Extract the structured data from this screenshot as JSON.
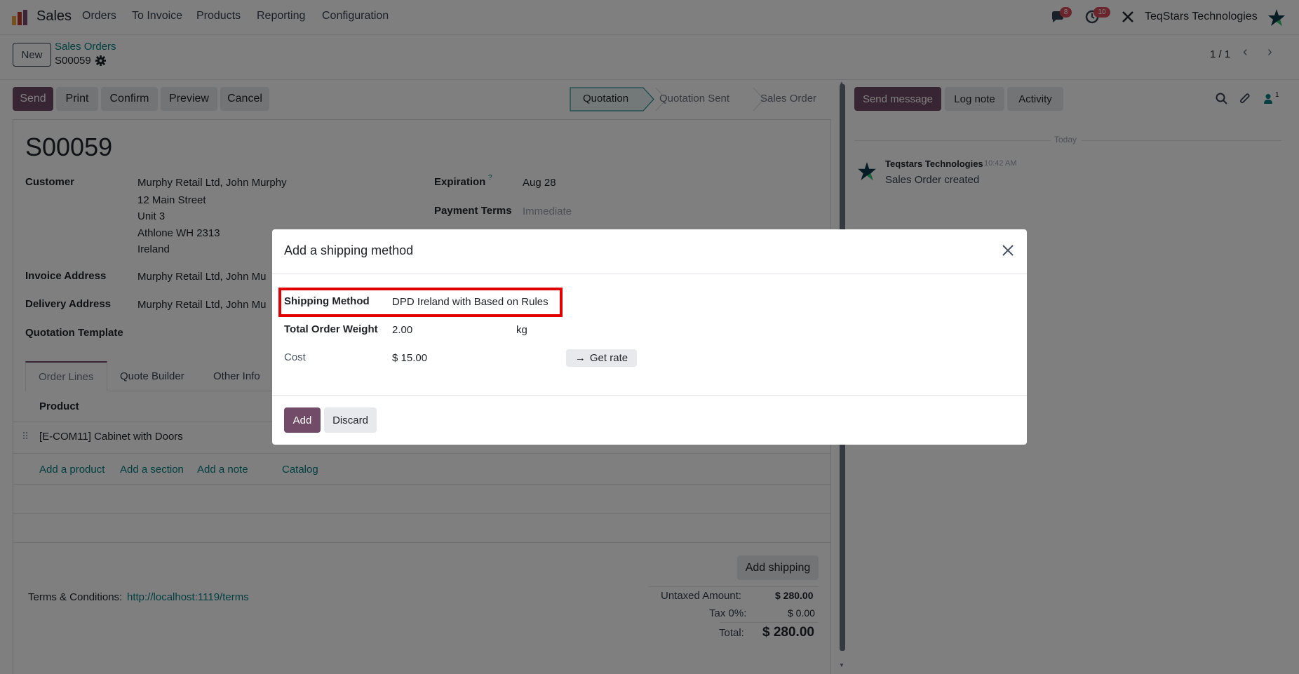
{
  "app": {
    "name": "Sales",
    "menu": [
      "Orders",
      "To Invoice",
      "Products",
      "Reporting",
      "Configuration"
    ],
    "company": "TeqStars Technologies",
    "messages_badge": "8",
    "activities_badge": "10"
  },
  "control_panel": {
    "new_label": "New",
    "breadcrumb_parent": "Sales Orders",
    "record_name": "S00059",
    "pager": "1 / 1"
  },
  "actions": {
    "send": "Send",
    "print": "Print",
    "confirm": "Confirm",
    "preview": "Preview",
    "cancel": "Cancel"
  },
  "statusbar": [
    "Quotation",
    "Quotation Sent",
    "Sales Order"
  ],
  "form": {
    "title": "S00059",
    "customer_label": "Customer",
    "customer_lines": [
      "Murphy Retail Ltd, John Murphy",
      "12 Main Street",
      "Unit 3",
      "Athlone WH 2313",
      "Ireland"
    ],
    "invoice_label": "Invoice Address",
    "invoice_value": "Murphy Retail Ltd, John Mu",
    "delivery_label": "Delivery Address",
    "delivery_value": "Murphy Retail Ltd, John Mu",
    "template_label": "Quotation Template",
    "expiration_label": "Expiration",
    "expiration_help": "?",
    "expiration_value": "Aug 28",
    "payment_label": "Payment Terms",
    "payment_value": "Immediate"
  },
  "tabs": [
    "Order Lines",
    "Quote Builder",
    "Other Info"
  ],
  "order_lines": {
    "product_header": "Product",
    "rows": [
      "[E-COM11] Cabinet with Doors"
    ],
    "add_links": [
      "Add a product",
      "Add a section",
      "Add a note",
      "Catalog"
    ]
  },
  "footer": {
    "add_shipping": "Add shipping",
    "terms_label": "Terms & Conditions:",
    "terms_link": "http://localhost:1119/terms",
    "untaxed_label": "Untaxed Amount:",
    "untaxed_value": "$ 280.00",
    "tax_label": "Tax 0%:",
    "tax_value": "$ 0.00",
    "total_label": "Total:",
    "total_value": "$ 280.00"
  },
  "chatter": {
    "send_message": "Send message",
    "log_note": "Log note",
    "activity": "Activity",
    "followers_count": "1",
    "date_separator": "Today",
    "author": "Teqstars Technologies",
    "time": "10:42 AM",
    "message": "Sales Order created"
  },
  "dialog": {
    "title": "Add a shipping method",
    "shipping_method_label": "Shipping Method",
    "shipping_method_value": "DPD Ireland with Based on Rules",
    "weight_label": "Total Order Weight",
    "weight_value": "2.00",
    "weight_unit": "kg",
    "cost_label": "Cost",
    "cost_value": "$ 15.00",
    "get_rate": "Get rate",
    "add": "Add",
    "discard": "Discard"
  },
  "colors": {
    "primary": "#714b67",
    "link": "#017e84",
    "highlight": "#e00000",
    "badge": "#d44c59"
  }
}
